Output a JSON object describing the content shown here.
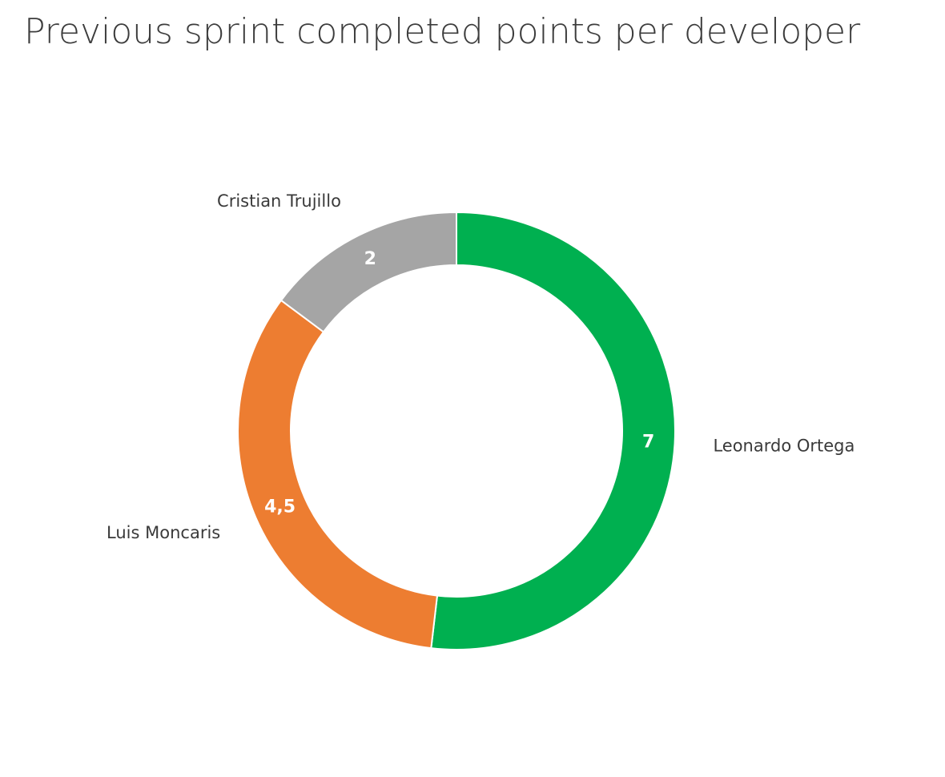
{
  "chart_data": {
    "type": "pie",
    "variant": "donut",
    "title": "Previous sprint completed points per developer",
    "categories": [
      "Leonardo Ortega",
      "Luis Moncaris",
      "Cristian Trujillo"
    ],
    "values": [
      7,
      4.5,
      2
    ],
    "value_labels": [
      "7",
      "4,5",
      "2"
    ],
    "colors": [
      "#00b050",
      "#ed7d31",
      "#a5a5a5"
    ],
    "start_angle": "12 o'clock",
    "direction": "clockwise",
    "legend": "none"
  }
}
